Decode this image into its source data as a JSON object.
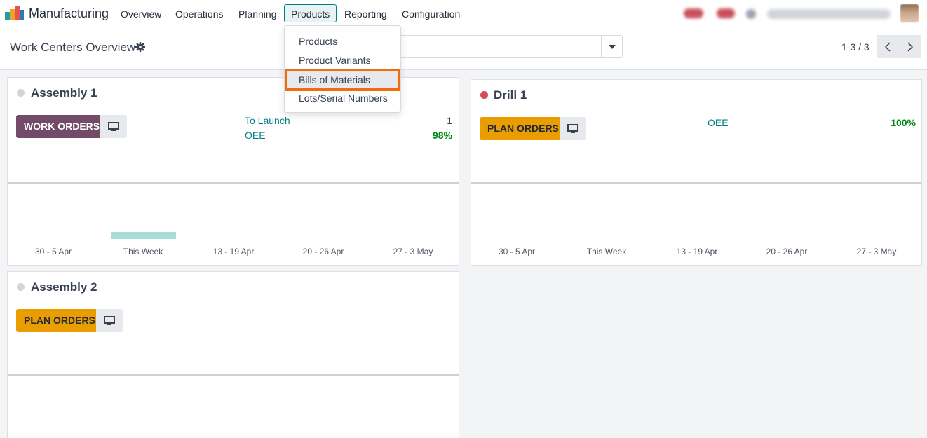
{
  "app": {
    "name": "Manufacturing",
    "menu": [
      "Overview",
      "Operations",
      "Planning",
      "Products",
      "Reporting",
      "Configuration"
    ],
    "active_menu": "Products"
  },
  "dropdown": {
    "items": [
      "Products",
      "Product Variants",
      "Bills of Materials",
      "Lots/Serial Numbers"
    ],
    "highlighted": "Bills of Materials"
  },
  "control_panel": {
    "title": "Work Centers Overview",
    "pager": "1-3 / 3"
  },
  "cards": [
    {
      "title": "Assembly 1",
      "status_color": "#d1d5db",
      "button_label": "WORK ORDERS",
      "button_color": "#714b67",
      "stats": [
        {
          "label": "To Launch",
          "value": "1"
        },
        {
          "label": "OEE",
          "value": "98%"
        }
      ],
      "weeks": [
        "30 - 5 Apr",
        "This Week",
        "13 - 19 Apr",
        "20 - 26 Apr",
        "27 - 3 May"
      ],
      "week_load": [
        0,
        1,
        0,
        0,
        0
      ]
    },
    {
      "title": "Drill 1",
      "status_color": "#d44c59",
      "button_label": "PLAN ORDERS",
      "button_color": "#e99d00",
      "stats": [
        {
          "label": "OEE",
          "value": "100%"
        }
      ],
      "weeks": [
        "30 - 5 Apr",
        "This Week",
        "13 - 19 Apr",
        "20 - 26 Apr",
        "27 - 3 May"
      ],
      "week_load": [
        0,
        0,
        0,
        0,
        0
      ]
    },
    {
      "title": "Assembly 2",
      "status_color": "#d1d5db",
      "button_label": "PLAN ORDERS",
      "button_color": "#e99d00",
      "stats": [],
      "weeks": [],
      "week_load": []
    }
  ],
  "colors": {
    "accent": "#017e84",
    "highlight_outline": "#f26b0f",
    "load_bar": "#a8ded8"
  }
}
